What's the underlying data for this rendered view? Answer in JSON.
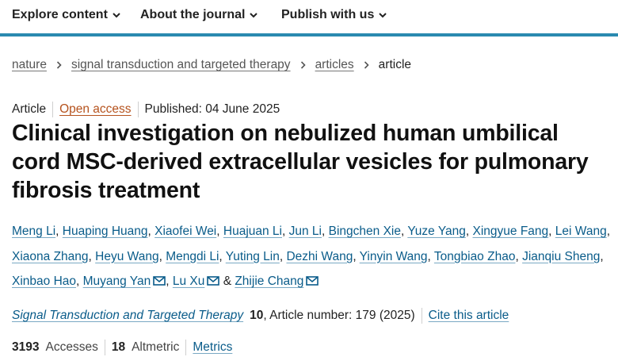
{
  "nav": {
    "items": [
      {
        "label": "Explore content"
      },
      {
        "label": "About the journal"
      },
      {
        "label": "Publish with us"
      }
    ]
  },
  "breadcrumb": {
    "items": [
      "nature",
      "signal transduction and targeted therapy",
      "articles"
    ],
    "current": "article"
  },
  "meta": {
    "type": "Article",
    "access": "Open access",
    "published": "Published: 04 June 2025"
  },
  "title": "Clinical investigation on nebulized human umbilical cord MSC-derived extracellular vesicles for pulmonary fibrosis treatment",
  "authors": {
    "list": [
      "Meng Li",
      "Huaping Huang",
      "Xiaofei Wei",
      "Huajuan Li",
      "Jun Li",
      "Bingchen Xie",
      "Yuze Yang",
      "Xingyue Fang",
      "Lei Wang",
      "Xiaona Zhang",
      "Heyu Wang",
      "Mengdi Li",
      "Yuting Lin",
      "Dezhi Wang",
      "Yinyin Wang",
      "Tongbiao Zhao",
      "Jianqiu Sheng",
      "Xinbao Hao",
      "Muyang Yan",
      "Lu Xu",
      "Zhijie Chang"
    ],
    "separator": ", ",
    "conjunction": " & "
  },
  "citation": {
    "journal": "Signal Transduction and Targeted Therapy",
    "volume": "10",
    "article_info": ", Article number: 179 (2025)",
    "cite_label": "Cite this article"
  },
  "metrics": {
    "accesses_value": "3193",
    "accesses_label": "Accesses",
    "altmetric_value": "18",
    "altmetric_label": "Altmetric",
    "metrics_link": "Metrics"
  },
  "colors": {
    "accent_bar": "#2a8ab0",
    "link": "#0a5c8a",
    "open_access": "#b5521d"
  }
}
